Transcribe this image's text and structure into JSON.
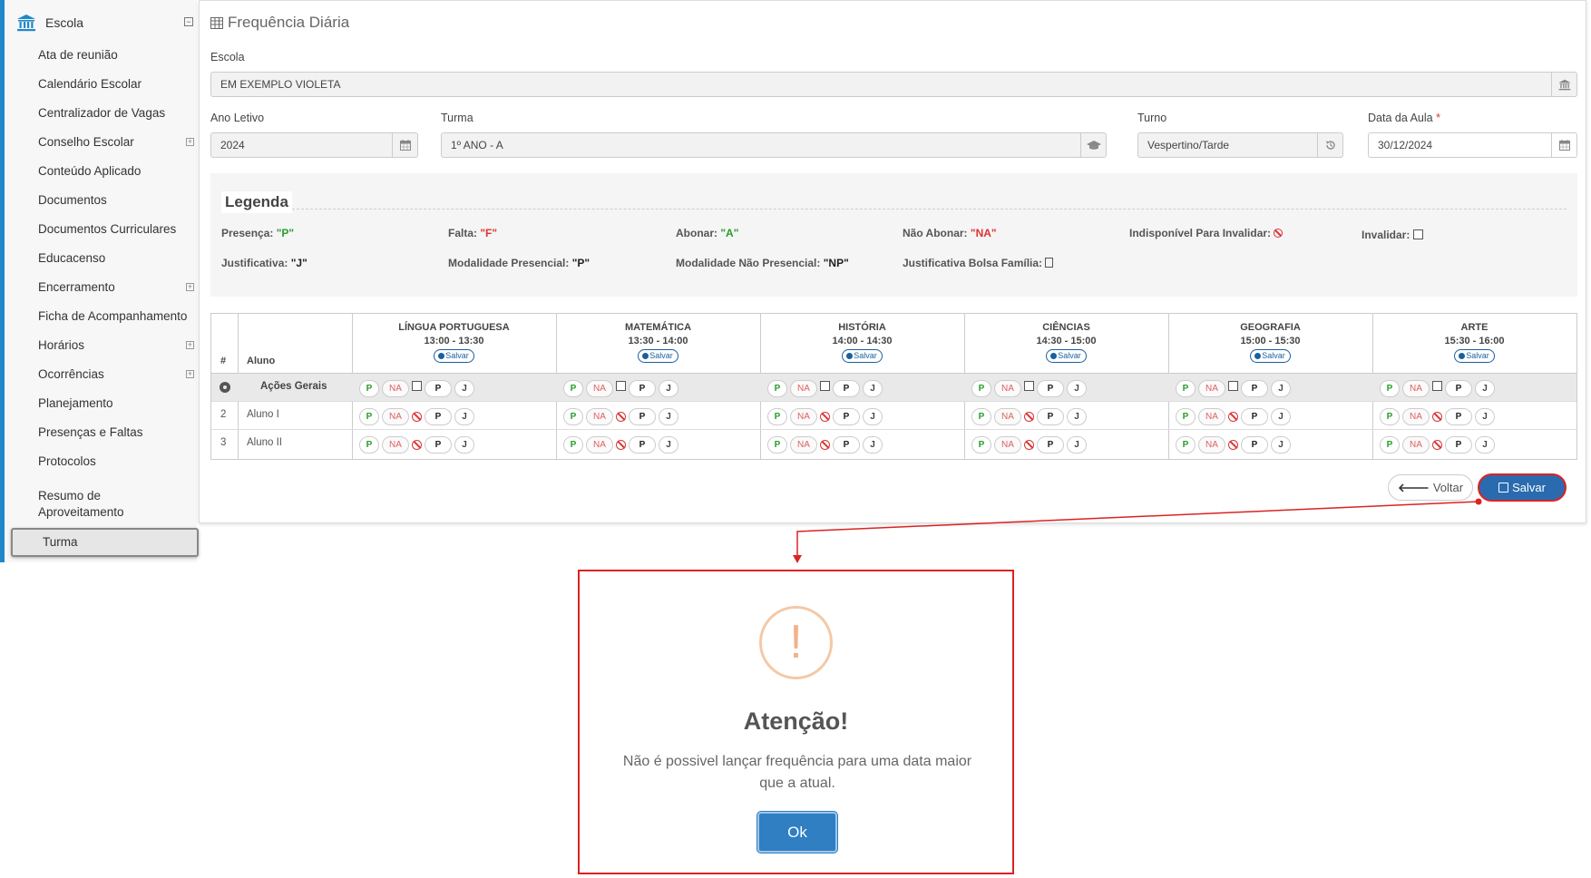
{
  "sidebar": {
    "title": "Escola",
    "collapse_symbol": "⊟",
    "expand_symbol": "+",
    "items": [
      {
        "label": "Ata de reunião"
      },
      {
        "label": "Calendário Escolar"
      },
      {
        "label": "Centralizador de Vagas"
      },
      {
        "label": "Conselho Escolar"
      },
      {
        "label": "Conteúdo Aplicado"
      },
      {
        "label": "Documentos"
      },
      {
        "label": "Documentos Curriculares"
      },
      {
        "label": "Educacenso"
      },
      {
        "label": "Encerramento"
      },
      {
        "label": "Ficha de Acompanhamento"
      },
      {
        "label": "Horários"
      },
      {
        "label": "Ocorrências"
      },
      {
        "label": "Planejamento"
      },
      {
        "label": "Presenças e Faltas"
      },
      {
        "label": "Protocolos"
      },
      {
        "label": "Resumo de Aproveitamento"
      },
      {
        "label": "Turma"
      }
    ]
  },
  "page": {
    "title": "Frequência Diária"
  },
  "form": {
    "escola_label": "Escola",
    "escola_value": "EM EXEMPLO VIOLETA",
    "ano_label": "Ano Letivo",
    "ano_value": "2024",
    "turma_label": "Turma",
    "turma_value": "1º ANO - A",
    "turno_label": "Turno",
    "turno_value": "Vespertino/Tarde",
    "data_label": "Data da Aula",
    "data_required": "*",
    "data_value": "30/12/2024"
  },
  "legend": {
    "title": "Legenda",
    "presenca_label": "Presença:",
    "presenca_code": "\"P\"",
    "falta_label": "Falta:",
    "falta_code": "\"F\"",
    "abonar_label": "Abonar:",
    "abonar_code": "\"A\"",
    "nao_abonar_label": "Não Abonar:",
    "nao_abonar_code": "\"NA\"",
    "indisponivel_label": "Indisponível Para Invalidar:",
    "invalidar_label": "Invalidar:",
    "justificativa_label": "Justificativa:",
    "justificativa_code": "\"J\"",
    "presencial_label": "Modalidade Presencial:",
    "presencial_code": "\"P\"",
    "nao_presencial_label": "Modalidade Não Presencial:",
    "nao_presencial_code": "\"NP\"",
    "bolsa_label": "Justificativa Bolsa Família:"
  },
  "table": {
    "hash_header": "#",
    "aluno_header": "Aluno",
    "save_pill_label": "Salvar",
    "subjects": [
      {
        "name": "LÍNGUA PORTUGUESA",
        "time": "13:00 - 13:30"
      },
      {
        "name": "MATEMÁTICA",
        "time": "13:30 - 14:00"
      },
      {
        "name": "HISTÓRIA",
        "time": "14:00 - 14:30"
      },
      {
        "name": "CIÊNCIAS",
        "time": "14:30 - 15:00"
      },
      {
        "name": "GEOGRAFIA",
        "time": "15:00 - 15:30"
      },
      {
        "name": "ARTE",
        "time": "15:30 - 16:00"
      }
    ],
    "general_actions": "Ações Gerais",
    "rows": [
      {
        "num": "2",
        "name": "Aluno I"
      },
      {
        "num": "3",
        "name": "Aluno II"
      }
    ],
    "btn_p": "P",
    "btn_na": "NA",
    "btn_pp": "P",
    "btn_j": "J"
  },
  "actions": {
    "voltar": "Voltar",
    "salvar": "Salvar"
  },
  "modal": {
    "icon": "!",
    "title": "Atenção!",
    "message": "Não é possivel lançar frequência para uma data maior que a atual.",
    "ok": "Ok"
  },
  "colors": {
    "accent": "#2a6bb0",
    "highlight": "#dd2222",
    "present": "#2a9d2a",
    "absent": "#dd3333",
    "warning": "#f3b288"
  }
}
